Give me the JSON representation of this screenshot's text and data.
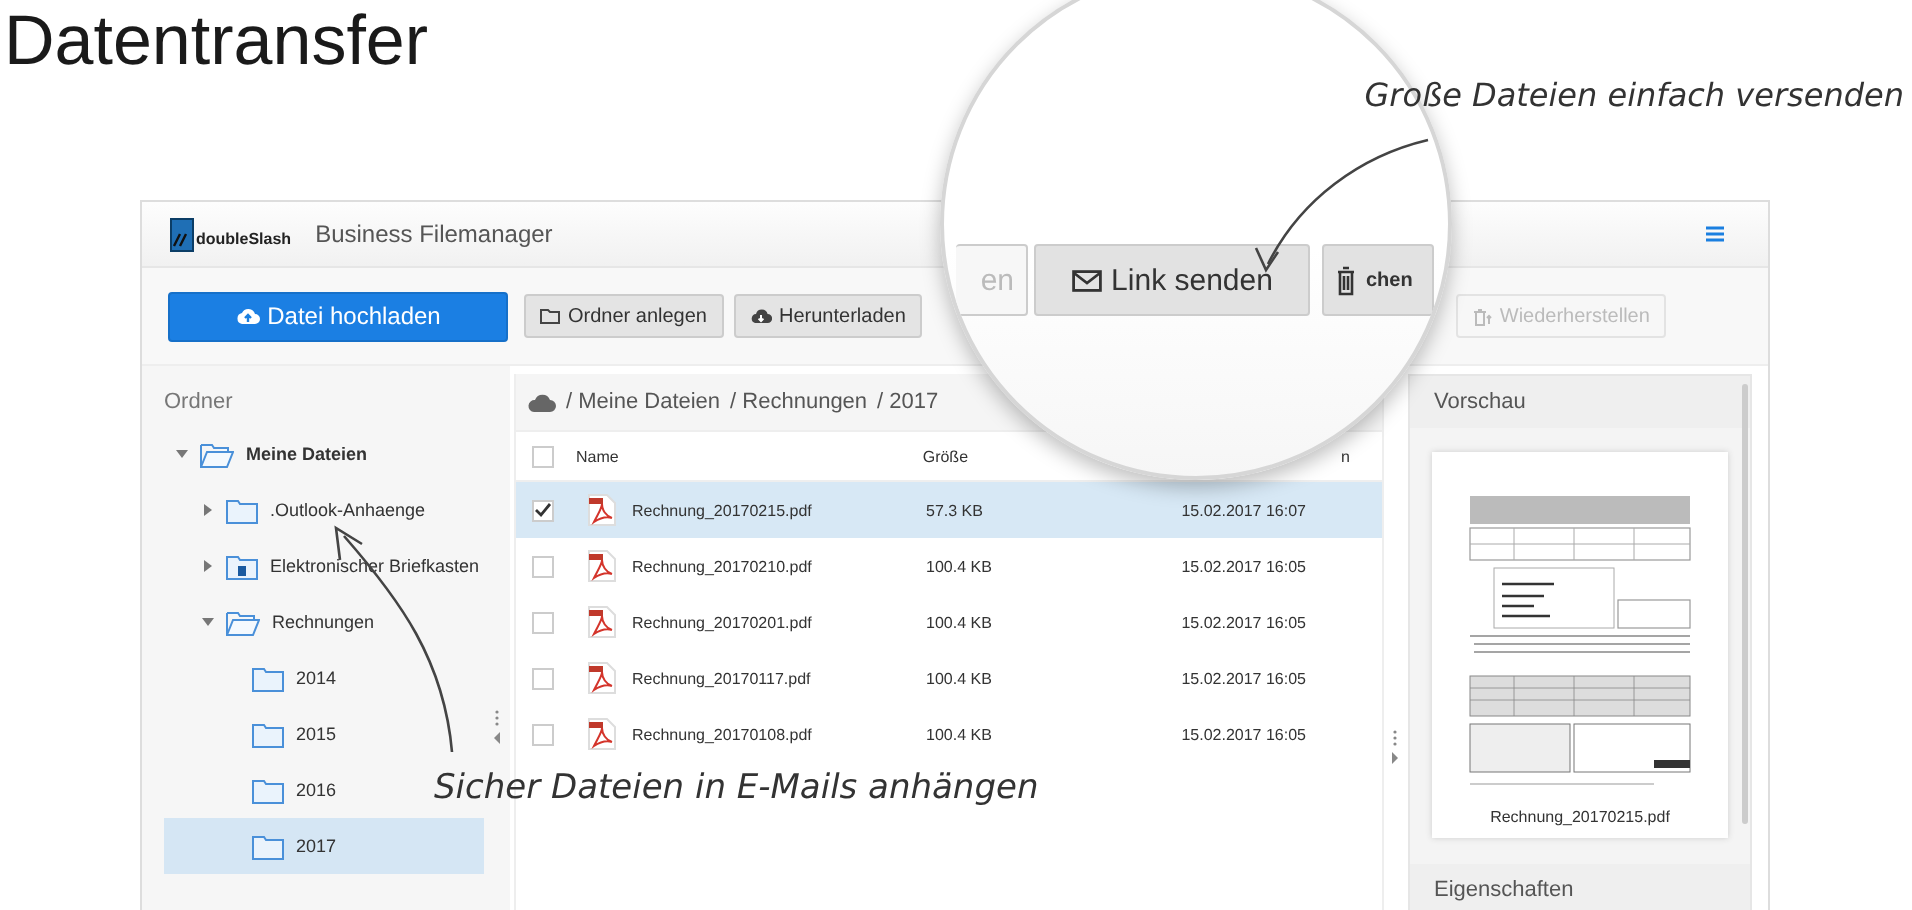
{
  "page_title": "Datentransfer",
  "annotations": [
    {
      "text": "Große Dateien einfach versenden"
    },
    {
      "text": "Sicher Dateien in E-Mails anhängen"
    }
  ],
  "app": {
    "brand": "doubleSlash",
    "name": "Business Filemanager"
  },
  "toolbar": [
    {
      "label": "Datei hochladen",
      "kind": "primary",
      "disabled": false
    },
    {
      "label": "Ordner anlegen",
      "kind": "folder",
      "disabled": false
    },
    {
      "label": "Herunterladen",
      "kind": "download",
      "disabled": false
    },
    {
      "label": "Wiederherstellen",
      "kind": "restore",
      "disabled": true
    }
  ],
  "magnifier": {
    "buttons": [
      {
        "label": "en",
        "kind": "plain"
      },
      {
        "label": "Link senden",
        "kind": "mail"
      },
      {
        "label": "chen",
        "kind": "trash"
      }
    ]
  },
  "tree": {
    "title": "Ordner",
    "items": [
      {
        "label": "Meine Dateien",
        "kind": "folder",
        "expanded": true,
        "selected": false,
        "children": [
          {
            "label": ".Outlook-Anhaenge",
            "kind": "folder",
            "expanded": false,
            "selected": false
          },
          {
            "label": "Elektronischer Briefkasten",
            "kind": "mailbox",
            "expanded": false,
            "selected": false
          },
          {
            "label": "Rechnungen",
            "kind": "folder",
            "expanded": true,
            "selected": false,
            "children": [
              {
                "label": "2014",
                "kind": "folder",
                "selected": false
              },
              {
                "label": "2015",
                "kind": "folder",
                "selected": false
              },
              {
                "label": "2016",
                "kind": "folder",
                "selected": false
              },
              {
                "label": "2017",
                "kind": "folder",
                "selected": true
              }
            ]
          }
        ]
      }
    ]
  },
  "breadcrumb": [
    "/ Meine Dateien",
    "/ Rechnungen",
    "/ 2017"
  ],
  "table": {
    "columns": [
      "Name",
      "Größe",
      "n"
    ],
    "all_checked": false,
    "rows": [
      {
        "name": "Rechnung_20170215.pdf",
        "size": "57.3 KB",
        "date": "15.02.2017 16:07",
        "checked": true,
        "selected": true
      },
      {
        "name": "Rechnung_20170210.pdf",
        "size": "100.4 KB",
        "date": "15.02.2017 16:05",
        "checked": false,
        "selected": false
      },
      {
        "name": "Rechnung_20170201.pdf",
        "size": "100.4 KB",
        "date": "15.02.2017 16:05",
        "checked": false,
        "selected": false
      },
      {
        "name": "Rechnung_20170117.pdf",
        "size": "100.4 KB",
        "date": "15.02.2017 16:05",
        "checked": false,
        "selected": false
      },
      {
        "name": "Rechnung_20170108.pdf",
        "size": "100.4 KB",
        "date": "15.02.2017 16:05",
        "checked": false,
        "selected": false
      }
    ]
  },
  "preview": {
    "title": "Vorschau",
    "filename": "Rechnung_20170215.pdf",
    "next_section": "Eigenschaften"
  }
}
